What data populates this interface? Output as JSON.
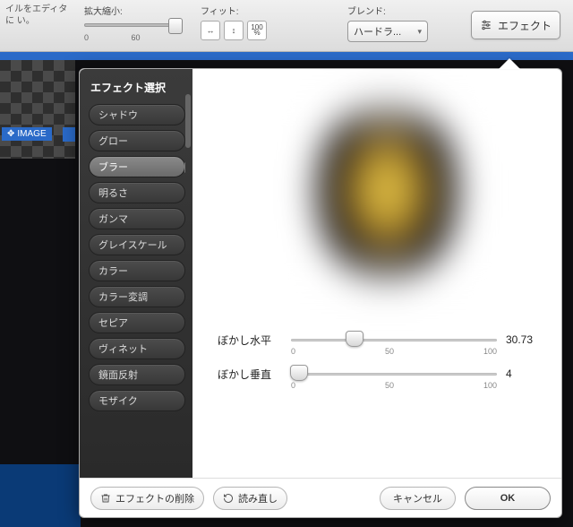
{
  "topbar": {
    "snippet": "イルをエディタに\nい。",
    "scale": {
      "label": "拡大縮小:",
      "min": "0",
      "mid": "60"
    },
    "fit": {
      "label": "フィット:",
      "hundred": "100",
      "pct": "%"
    },
    "blend": {
      "label": "ブレンド:",
      "value": "ハードラ..."
    },
    "effect_btn": "エフェクト"
  },
  "image_tag": "IMAGE",
  "dialog": {
    "title": "エフェクト選択",
    "effects": [
      {
        "label": "シャドウ"
      },
      {
        "label": "グロー"
      },
      {
        "label": "ブラー",
        "selected": true
      },
      {
        "label": "明るさ"
      },
      {
        "label": "ガンマ"
      },
      {
        "label": "グレイスケール"
      },
      {
        "label": "カラー"
      },
      {
        "label": "カラー変調"
      },
      {
        "label": "セピア"
      },
      {
        "label": "ヴィネット"
      },
      {
        "label": "鏡面反射"
      },
      {
        "label": "モザイク"
      }
    ],
    "params": {
      "blur_h": {
        "label": "ぼかし水平",
        "value": "30.73",
        "min": "0",
        "mid": "50",
        "max": "100",
        "pos": 0.3073
      },
      "blur_v": {
        "label": "ぼかし垂直",
        "value": "4",
        "min": "0",
        "mid": "50",
        "max": "100",
        "pos": 0.04
      }
    },
    "footer": {
      "delete": "エフェクトの削除",
      "reload": "読み直し",
      "cancel": "キャンセル",
      "ok": "OK"
    }
  }
}
